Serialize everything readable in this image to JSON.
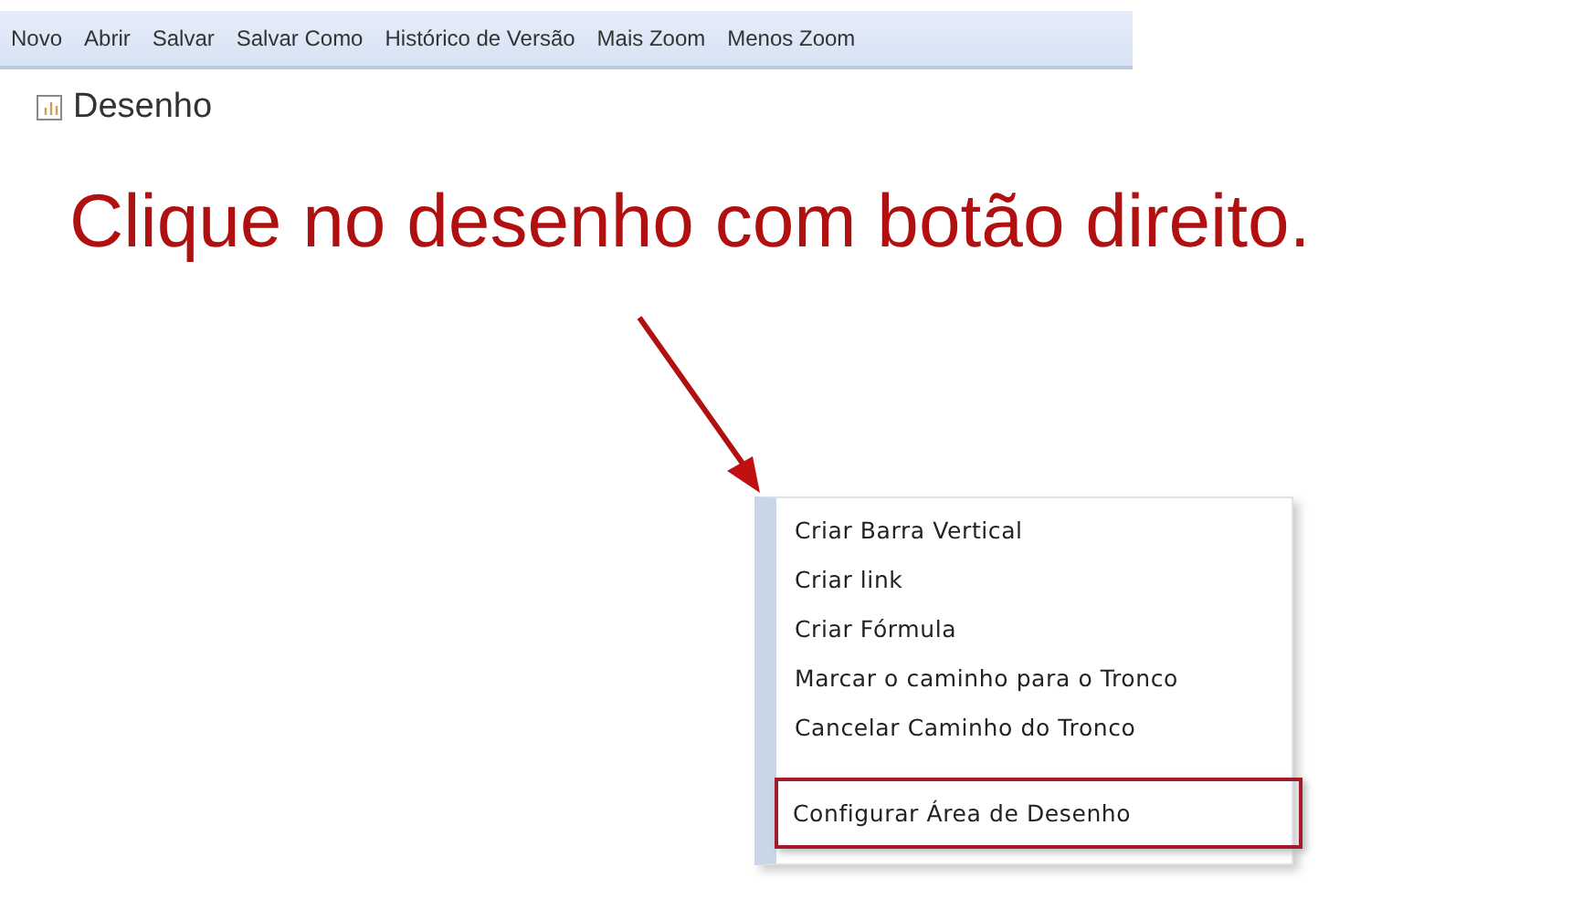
{
  "toolbar": [
    "Novo",
    "Abrir",
    "Salvar",
    "Salvar Como",
    "Histórico de Versão",
    "Mais Zoom",
    "Menos Zoom"
  ],
  "page_title": "Desenho",
  "instruction": "Clique no desenho com botão direito.",
  "context_menu": {
    "groups": [
      [
        {
          "label": "Criar Barra Vertical",
          "selected": false
        },
        {
          "label": "Criar link",
          "selected": false
        },
        {
          "label": "Criar Fórmula",
          "selected": false
        },
        {
          "label": "Marcar o caminho para o Tronco",
          "selected": false
        },
        {
          "label": "Cancelar Caminho do Tronco",
          "selected": false
        }
      ],
      [
        {
          "label": "Configurar Área de Desenho",
          "selected": true
        }
      ]
    ]
  }
}
